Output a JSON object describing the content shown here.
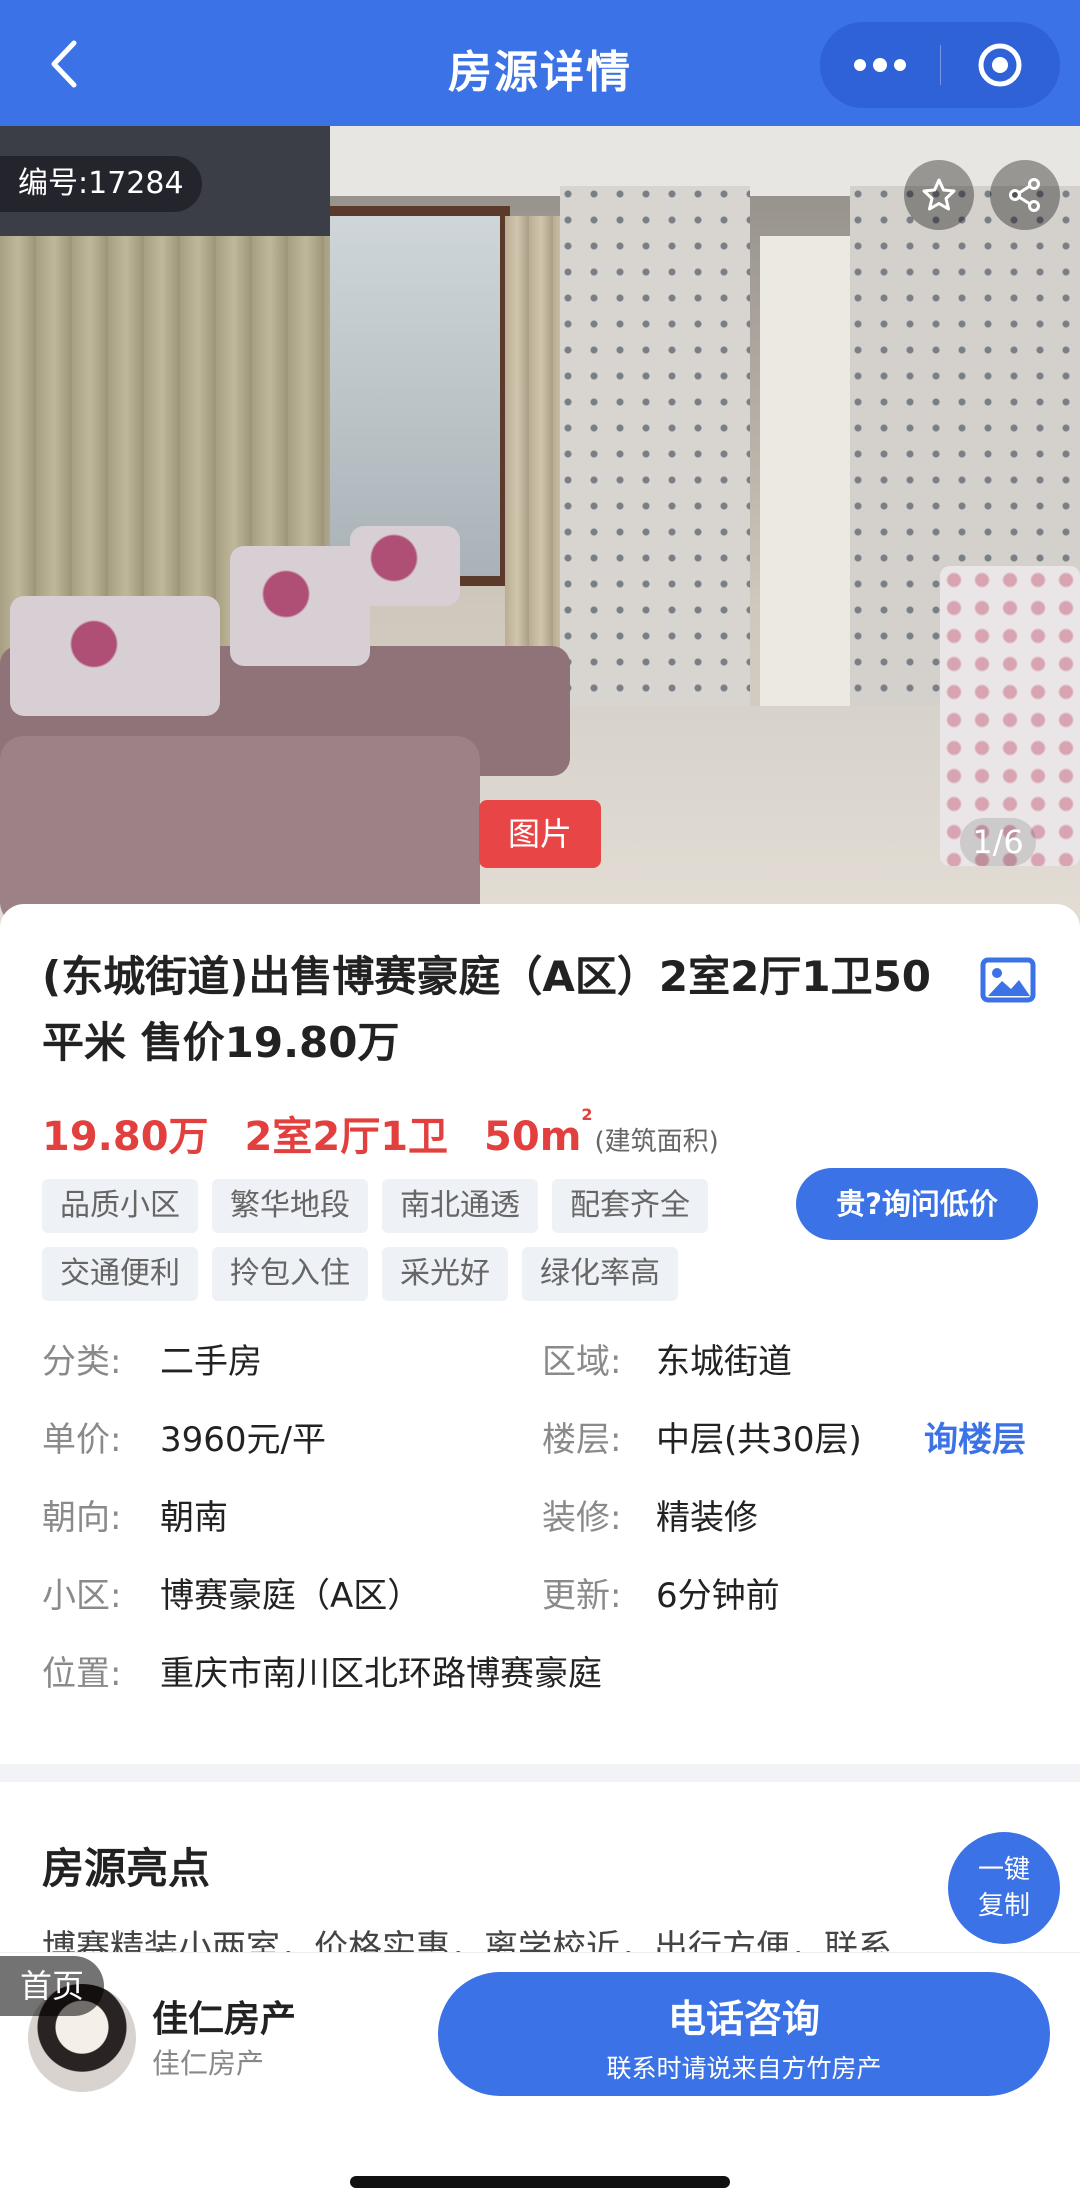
{
  "header": {
    "title": "房源详情"
  },
  "photo": {
    "id_label": "编号:17284",
    "badge": "图片",
    "counter": "1/6"
  },
  "listing": {
    "title": "(东城街道)出售博赛豪庭（A区）2室2厅1卫50平米 售价19.80万",
    "price": "19.80万",
    "layout": "2室2厅1卫",
    "area": "50m",
    "area_sup": "2",
    "area_note": "(建筑面积)",
    "tags": [
      "品质小区",
      "繁华地段",
      "南北通透",
      "配套齐全",
      "交通便利",
      "拎包入住",
      "采光好",
      "绿化率高"
    ],
    "ask_price_button": "贵?询问低价"
  },
  "details": {
    "category_key": "分类:",
    "category_val": "二手房",
    "district_key": "区域:",
    "district_val": "东城街道",
    "unit_price_key": "单价:",
    "unit_price_val": "3960元/平",
    "floor_key": "楼层:",
    "floor_val": "中层(共30层)",
    "ask_floor": "询楼层",
    "orientation_key": "朝向:",
    "orientation_val": "朝南",
    "decoration_key": "装修:",
    "decoration_val": "精装修",
    "community_key": "小区:",
    "community_val": "博赛豪庭（A区）",
    "update_key": "更新:",
    "update_val": "6分钟前",
    "location_key": "位置:",
    "location_val": "重庆市南川区北环路博赛豪庭"
  },
  "highlights": {
    "title": "房源亮点",
    "text": "博赛精装小两室，价格实惠，离学校近，出行方便，联系",
    "copy_line1": "一键",
    "copy_line2": "复制"
  },
  "bottom": {
    "home": "首页",
    "agent_name": "佳仁房产",
    "agent_sub": "佳仁房产",
    "call_title": "电话咨询",
    "call_sub": "联系时请说来自方竹房产"
  },
  "colors": {
    "brand": "#3b72e6",
    "price": "#e2403f"
  }
}
